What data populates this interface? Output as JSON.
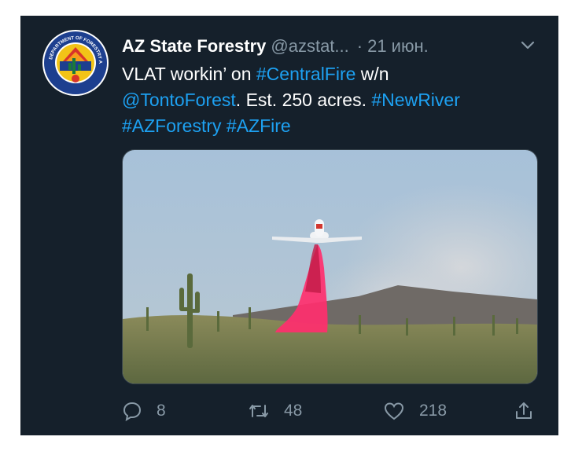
{
  "tweet": {
    "author_name": "AZ State Forestry",
    "handle": "@azstat...",
    "separator": "·",
    "date": "21 июн.",
    "avatar_icon": "az-forestry-seal",
    "seal_text": "DEPARTMENT OF FORESTRY AND FIRE MANAGEMENT",
    "text": {
      "part1": "VLAT workin’ on ",
      "hashtag_central": "#CentralFire",
      "part2": " w/n ",
      "mention": "@TontoForest",
      "part3": ". Est. 250 acres. ",
      "hashtag_newriver": "#NewRiver",
      "hashtag_azforestry": "#AZForestry",
      "hashtag_azfire": "#AZFire"
    },
    "media": {
      "description_icon": "airplane-dropping-retardant-photo"
    },
    "actions": {
      "reply_count": "8",
      "retweet_count": "48",
      "like_count": "218"
    },
    "colors": {
      "background": "#15202b",
      "link": "#1da1f2",
      "secondary_text": "#8899a6",
      "retardant": "#ff2f6e"
    }
  }
}
